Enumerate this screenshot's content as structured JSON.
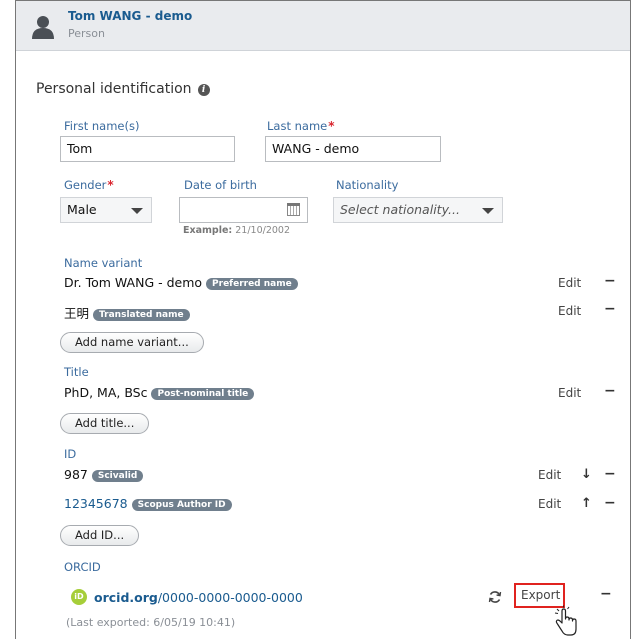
{
  "header": {
    "title": "Tom WANG - demo",
    "subtitle": "Person"
  },
  "section": {
    "title": "Personal identification"
  },
  "form": {
    "first_name_label": "First name(s)",
    "first_name_value": "Tom",
    "last_name_label": "Last name",
    "last_name_value": "WANG - demo",
    "required_mark": "*",
    "gender_label": "Gender",
    "gender_value": "Male",
    "dob_label": "Date of birth",
    "dob_value": "",
    "dob_hint_prefix": "Example:",
    "dob_hint_value": "21/10/2002",
    "nationality_label": "Nationality",
    "nationality_placeholder": "Select nationality..."
  },
  "name_variant": {
    "label": "Name variant",
    "items": [
      {
        "text": "Dr. Tom WANG - demo",
        "badge": "Preferred name",
        "edit": "Edit",
        "remove": "−"
      },
      {
        "text": "王明",
        "badge": "Translated name",
        "edit": "Edit",
        "remove": "−"
      }
    ],
    "add_button": "Add name variant..."
  },
  "title_section": {
    "label": "Title",
    "items": [
      {
        "text": "PhD, MA, BSc",
        "badge": "Post-nominal title",
        "edit": "Edit",
        "remove": "−"
      }
    ],
    "add_button": "Add title..."
  },
  "id_section": {
    "label": "ID",
    "items": [
      {
        "text": "987",
        "badge": "Scivalid",
        "edit": "Edit",
        "move": "↓",
        "remove": "−"
      },
      {
        "text": "12345678",
        "badge": "Scopus Author ID",
        "edit": "Edit",
        "move": "↑",
        "remove": "−"
      }
    ],
    "add_button": "Add ID..."
  },
  "orcid": {
    "label": "ORCID",
    "icon_text": "iD",
    "domain": "orcid.org",
    "path": "/0000-0000-0000-0000",
    "last_exported": "(Last exported: 6/05/19 10:41)",
    "export_label": "Export",
    "remove": "−"
  },
  "colors": {
    "link": "#1a5b8f",
    "required": "#d9262f",
    "badge": "#707f8d",
    "orcid_green": "#a6ce39",
    "highlight": "#e0231f"
  }
}
